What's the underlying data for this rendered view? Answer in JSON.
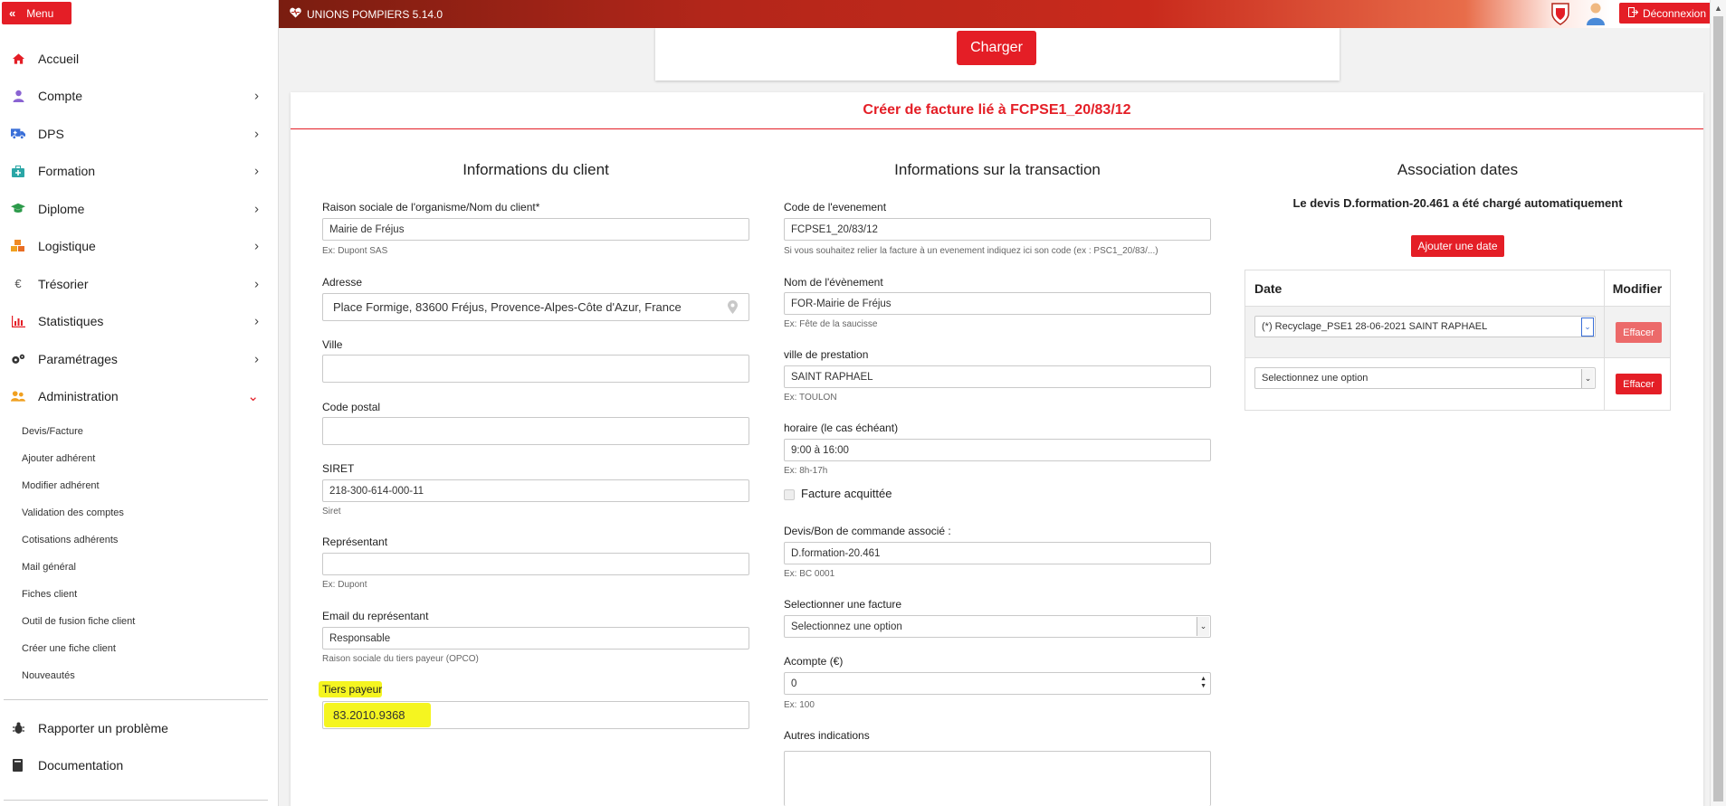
{
  "sidebar": {
    "menu_label": "Menu",
    "items": [
      {
        "label": "Accueil",
        "icon": "home-icon",
        "color": "#e41e26"
      },
      {
        "label": "Compte",
        "icon": "user-icon",
        "color": "#8a63d2"
      },
      {
        "label": "DPS",
        "icon": "ambulance-icon",
        "color": "#3a6fd8"
      },
      {
        "label": "Formation",
        "icon": "kit-icon",
        "color": "#2aa6a6"
      },
      {
        "label": "Diplome",
        "icon": "graduation-cap-icon",
        "color": "#2c9a4a"
      },
      {
        "label": "Logistique",
        "icon": "cubes-icon",
        "color": "#f08a24"
      },
      {
        "label": "Trésorier",
        "icon": "euro-icon",
        "color": "#555555"
      },
      {
        "label": "Statistiques",
        "icon": "chart-icon",
        "color": "#e41e26"
      },
      {
        "label": "Paramétrages",
        "icon": "cogs-icon",
        "color": "#333333"
      },
      {
        "label": "Administration",
        "icon": "users-icon",
        "color": "#f0a020"
      }
    ],
    "sub_items": [
      "Devis/Facture",
      "Ajouter adhérent",
      "Modifier adhérent",
      "Validation des comptes",
      "Cotisations adhérents",
      "Mail général",
      "Fiches client",
      "Outil de fusion fiche client",
      "Créer une fiche client",
      "Nouveautés"
    ],
    "footer": [
      {
        "label": "Rapporter un problème",
        "icon": "bug-icon"
      },
      {
        "label": "Documentation",
        "icon": "book-icon"
      }
    ]
  },
  "topbar": {
    "app_title": "UNIONS POMPIERS 5.14.0",
    "logout_label": "Déconnexion"
  },
  "charger": {
    "label": "Charger"
  },
  "card": {
    "title": "Créer de facture lié à FCPSE1_20/83/12"
  },
  "client": {
    "title": "Informations du client",
    "raison_label": "Raison sociale de l'organisme/Nom du client*",
    "raison_value": "Mairie de Fréjus",
    "raison_hint": "Ex: Dupont SAS",
    "adresse_label": "Adresse",
    "adresse_value": "Place Formige, 83600 Fréjus, Provence-Alpes-Côte d'Azur, France",
    "ville_label": "Ville",
    "ville_value": "",
    "cp_label": "Code postal",
    "cp_value": "",
    "siret_label": "SIRET",
    "siret_value": "218-300-614-000-11",
    "siret_hint": "Siret",
    "rep_label": "Représentant",
    "rep_value": "",
    "rep_hint": "Ex: Dupont",
    "email_label": "Email du représentant",
    "email_value": "Responsable",
    "email_hint": "Raison sociale du tiers payeur (OPCO)",
    "tiers_label": "Tiers payeur",
    "tiers_value": "83.2010.9368"
  },
  "transaction": {
    "title": "Informations sur la transaction",
    "code_label": "Code de l'evenement",
    "code_value": "FCPSE1_20/83/12",
    "code_hint": "Si vous souhaitez relier la facture à un evenement indiquez ici son code (ex : PSC1_20/83/...)",
    "nom_label": "Nom de l'évènement",
    "nom_value": "FOR-Mairie de Fréjus",
    "nom_hint": "Ex: Fête de la saucisse",
    "ville_label": "ville de prestation",
    "ville_value": "SAINT RAPHAEL",
    "ville_hint": "Ex: TOULON",
    "horaire_label": "horaire (le cas échéant)",
    "horaire_value": "9:00 à 16:00",
    "horaire_hint": "Ex: 8h-17h",
    "acquittee_label": "Facture acquittée",
    "devis_label": "Devis/Bon de commande associé :",
    "devis_value": "D.formation-20.461",
    "devis_hint": "Ex: BC 0001",
    "facture_label": "Selectionner une facture",
    "facture_value": "Selectionnez une option",
    "acompte_label": "Acompte (€)",
    "acompte_value": "0",
    "acompte_hint": "Ex: 100",
    "autres_label": "Autres indications"
  },
  "dates": {
    "title": "Association dates",
    "notice": "Le devis D.formation-20.461 a été chargé automatiquement",
    "add_label": "Ajouter une date",
    "col_date": "Date",
    "col_modifier": "Modifier",
    "rows": [
      {
        "value": "(*) Recyclage_PSE1 28-06-2021 SAINT RAPHAEL",
        "button": "Effacer"
      },
      {
        "value": "Selectionnez une option",
        "button": "Effacer"
      }
    ]
  },
  "colors": {
    "accent": "#e41e26",
    "highlight": "#f5f520"
  }
}
